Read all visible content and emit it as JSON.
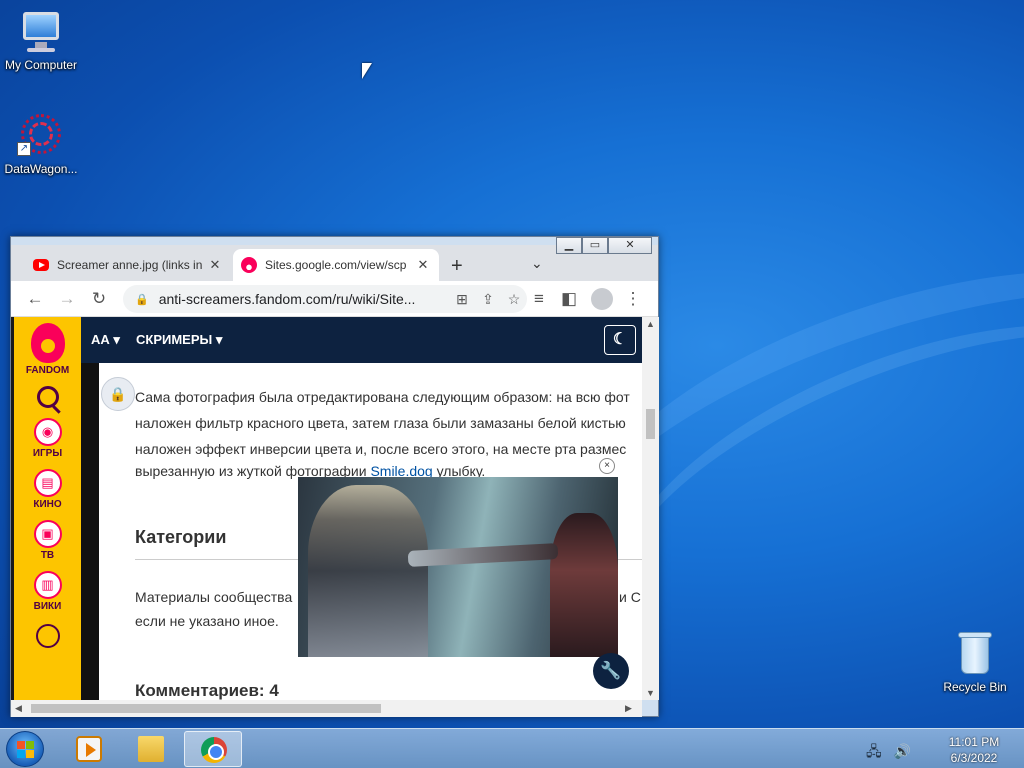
{
  "desktop": {
    "icons": [
      {
        "label": "My Computer"
      },
      {
        "label": "DataWagon..."
      },
      {
        "label": "Recycle Bin"
      }
    ]
  },
  "browser": {
    "tabs": [
      {
        "title": "Screamer anne.jpg (links in",
        "favicon": "youtube-icon"
      },
      {
        "title": "Sites.google.com/view/scp",
        "favicon": "fandom-icon"
      }
    ],
    "new_tab": "+",
    "tab_menu": "⌄",
    "url": "anti-screamers.fandom.com/ru/wiki/Site..."
  },
  "fandom_rail": {
    "brand": "FANDOM",
    "items": [
      {
        "label": "ИГРЫ",
        "icon": "gamepad-icon"
      },
      {
        "label": "КИНО",
        "icon": "film-icon"
      },
      {
        "label": "ТВ",
        "icon": "tv-icon"
      },
      {
        "label": "ВИКИ",
        "icon": "book-icon"
      }
    ]
  },
  "wiki_header": {
    "logo_text": "АА",
    "menu_label": "СКРИМЕРЫ"
  },
  "article": {
    "lines": [
      "Сама фотография была отредактирована следующим образом: на всю фот",
      "наложен фильтр красного цвета, затем глаза были замазаны белой кистью",
      "наложен эффект инверсии цвета и, после всего этого, на месте рта размес"
    ],
    "line4_prefix": "вырезанную из жуткой фотографии ",
    "line4_link": "Smile.dog",
    "line4_suffix": " улыбку.",
    "categories_heading": "Категории",
    "community_line1": "Материалы сообщества",
    "community_line1_tail": "и С",
    "community_line2": "если не указано иное.",
    "comments_heading": "Комментариев: 4"
  },
  "video": {
    "close": "×"
  },
  "taskbar": {
    "time": "11:01 PM",
    "date": "6/3/2022"
  },
  "colors": {
    "fandom_yellow": "#fdc500",
    "fandom_pink": "#fa005a",
    "wiki_header": "#0d2240",
    "link": "#0052a3"
  }
}
